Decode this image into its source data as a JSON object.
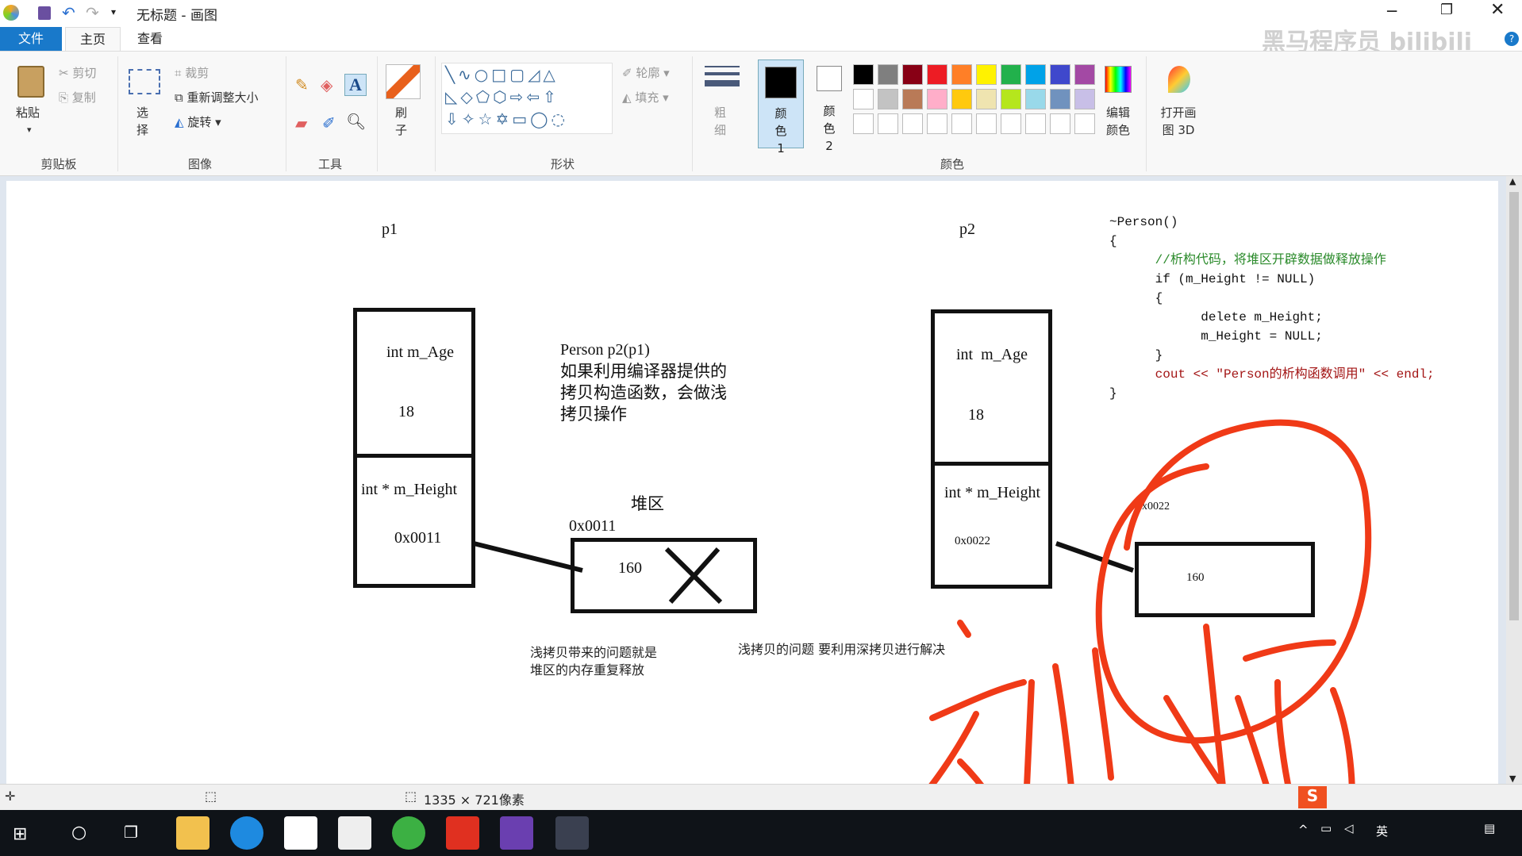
{
  "window": {
    "title": "无标题 - 画图",
    "watermark": "黑马程序员 bilibili"
  },
  "tabs": [
    {
      "label": "文件"
    },
    {
      "label": "主页"
    },
    {
      "label": "查看"
    }
  ],
  "ribbon": {
    "clipboard": {
      "paste": "粘贴",
      "cut": "剪切",
      "copy": "复制",
      "group": "剪贴板"
    },
    "image": {
      "select": "选择",
      "crop": "裁剪",
      "resize": "重新调整大小",
      "rotate": "旋转",
      "group": "图像"
    },
    "tools": {
      "group": "工具"
    },
    "brush": {
      "label": "刷子"
    },
    "shapes": {
      "outline": "轮廓",
      "fill": "填充",
      "group": "形状"
    },
    "size": {
      "label": "粗细"
    },
    "color1": {
      "label": "颜色 1",
      "value": "#000000"
    },
    "color2": {
      "label": "颜色 2",
      "value": "#ffffff"
    },
    "colors": {
      "group": "颜色",
      "palette_row1": [
        "#000000",
        "#7f7f7f",
        "#880015",
        "#ed1c24",
        "#ff7f27",
        "#fff200",
        "#22b14c",
        "#00a2e8",
        "#3f48cc",
        "#a349a4"
      ],
      "palette_row2": [
        "#ffffff",
        "#c3c3c3",
        "#b97a57",
        "#ffaec9",
        "#ffc90e",
        "#efe4b0",
        "#b5e61d",
        "#99d9ea",
        "#7092be",
        "#c8bfe7"
      ]
    },
    "edit_colors": "编辑颜色",
    "paint3d": "打开画图 3D"
  },
  "drawing": {
    "p1": {
      "label": "p1",
      "age_field": "int m_Age",
      "age_value": "18",
      "height_field": "int * m_Height",
      "height_value": "0x0011"
    },
    "p2": {
      "label": "p2",
      "age_field": "int  m_Age",
      "age_value": "18",
      "height_field": "int * m_Height",
      "height_value": "0x0022"
    },
    "heap_label": "堆区",
    "heap1": {
      "address": "0x0011",
      "value": "160"
    },
    "heap2": {
      "address": "0x0022",
      "value": "160"
    },
    "note_lines": [
      "Person p2(p1)",
      "如果利用编译器提供的",
      "拷贝构造函数，会做浅",
      "拷贝操作"
    ],
    "caption1": [
      "浅拷贝带来的问题就是",
      "堆区的内存重复释放"
    ],
    "caption2": "浅拷贝的问题 要利用深拷贝进行解决",
    "code": [
      "~Person()",
      "{",
      "      //析构代码，将堆区开辟数据做释放操作",
      "      if (m_Height != NULL)",
      "      {",
      "            delete m_Height;",
      "            m_Height = NULL;",
      "      }",
      "      cout << \"Person的析构函数调用\" << endl;",
      "}"
    ],
    "handwriting": "深拷贝",
    "ink_color": "#f03a17"
  },
  "status": {
    "canvas_size": "1335 × 721像素"
  },
  "taskbar": {
    "tray_lang": "英"
  }
}
